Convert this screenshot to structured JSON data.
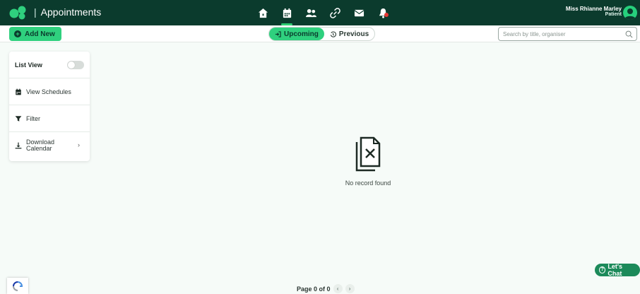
{
  "header": {
    "app_title": "Appointments",
    "separator": "|",
    "user_name": "Miss Rhianne Marley",
    "user_role": "Patient",
    "nav": [
      {
        "icon": "home-icon"
      },
      {
        "icon": "calendar-icon",
        "active": true
      },
      {
        "icon": "users-icon"
      },
      {
        "icon": "link-icon"
      },
      {
        "icon": "mail-icon"
      },
      {
        "icon": "bell-icon",
        "has_notification": true
      }
    ]
  },
  "toolbar": {
    "add_label": "Add New",
    "upcoming_label": "Upcoming",
    "previous_label": "Previous",
    "search_placeholder": "Search by title, organiser"
  },
  "sidebar": {
    "list_view_label": "List View",
    "list_view_on": false,
    "view_schedules_label": "View Schedules",
    "filter_label": "Filter",
    "download_label_1": "Download",
    "download_label_2": "Calendar"
  },
  "main": {
    "empty_message": "No record found"
  },
  "footer": {
    "page_label": "Page 0 of 0",
    "chat_label": "Let's Chat"
  },
  "colors": {
    "topbar": "#0b3b2d",
    "accent": "#2fd07e",
    "chat": "#1c8a5a"
  }
}
